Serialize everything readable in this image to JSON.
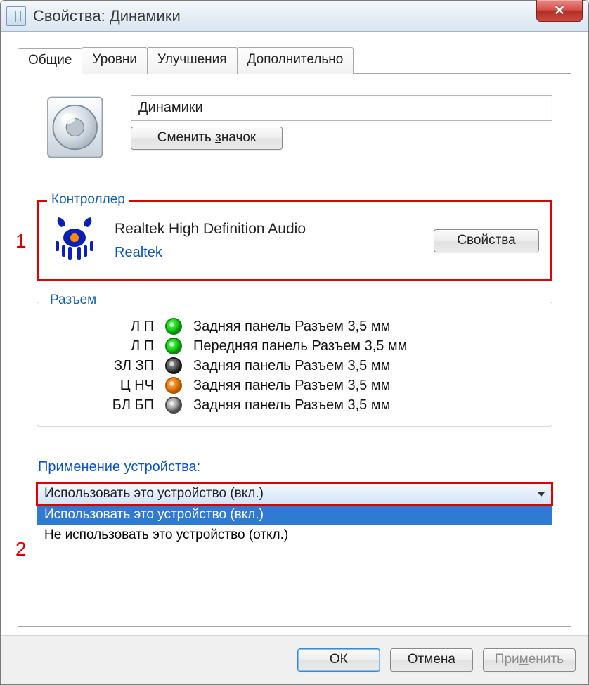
{
  "window": {
    "title": "Свойства: Динамики",
    "close_glyph": "✕"
  },
  "tabs": {
    "general": "Общие",
    "levels": "Уровни",
    "enhancements": "Улучшения",
    "advanced": "Дополнительно"
  },
  "device": {
    "name": "Динамики",
    "change_icon_prefix": "Сменить ",
    "change_icon_u": "з",
    "change_icon_suffix": "начок"
  },
  "annotations": {
    "one": "1",
    "two": "2"
  },
  "controller": {
    "legend": "Контроллер",
    "name": "Realtek High Definition Audio",
    "vendor_link": "Realtek",
    "props_prefix": "Сво",
    "props_u": "й",
    "props_suffix": "ства"
  },
  "jack_group": {
    "legend": "Разъем",
    "rows": [
      {
        "label": "Л П",
        "color_outer": "#0a8a0a",
        "color_inner": "#26e326",
        "desc": "Задняя панель Разъем 3,5 мм"
      },
      {
        "label": "Л П",
        "color_outer": "#0a8a0a",
        "color_inner": "#26e326",
        "desc": "Передняя панель Разъем 3,5 мм"
      },
      {
        "label": "ЗЛ ЗП",
        "color_outer": "#1a1a1a",
        "color_inner": "#6a6a6a",
        "desc": "Задняя панель Разъем 3,5 мм"
      },
      {
        "label": "Ц НЧ",
        "color_outer": "#b25600",
        "color_inner": "#f08b1e",
        "desc": "Задняя панель Разъем 3,5 мм"
      },
      {
        "label": "БЛ БП",
        "color_outer": "#4a4a4a",
        "color_inner": "#b4b4b4",
        "desc": "Задняя панель Разъем 3,5 мм"
      }
    ]
  },
  "usage": {
    "label": "Применение устройства:",
    "current": "Использовать это устройство (вкл.)",
    "options": [
      "Использовать это устройство (вкл.)",
      "Не использовать это устройство (откл.)"
    ]
  },
  "footer": {
    "ok": "ОК",
    "cancel": "Отмена",
    "apply_prefix": "При",
    "apply_u": "м",
    "apply_suffix": "енить"
  }
}
